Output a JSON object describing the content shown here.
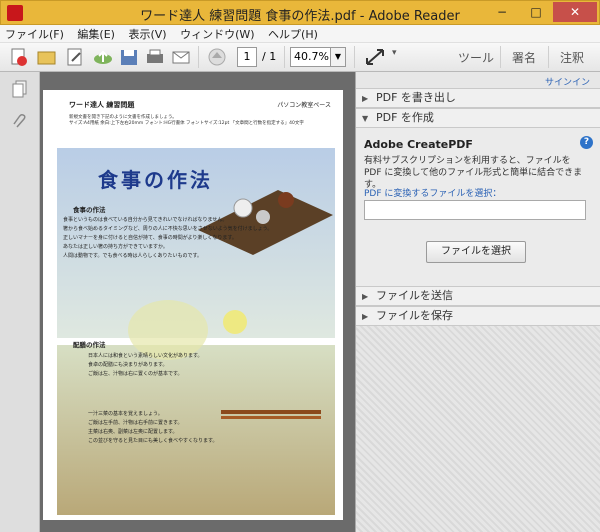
{
  "window": {
    "title": "ワード達人 練習問題 食事の作法.pdf - Adobe Reader"
  },
  "menu": [
    "ファイル(F)",
    "編集(E)",
    "表示(V)",
    "ウィンドウ(W)",
    "ヘルプ(H)"
  ],
  "toolbar": {
    "page_current": "1",
    "page_total": "/ 1",
    "zoom": "40.7%",
    "tools_label": "ツール",
    "sign_label": "署名",
    "comment_label": "注釈"
  },
  "panel": {
    "signin": "サインイン",
    "export_label": "PDF を書き出し",
    "create_label": "PDF を作成",
    "createpdf_title": "Adobe CreatePDF",
    "createpdf_desc": "有料サブスクリプションを利用すると、ファイルを PDF に変換して他のファイル形式と簡単に結合できます。",
    "select_label": "PDF に変換するファイルを選択：",
    "select_button": "ファイルを選択",
    "send_label": "ファイルを送信",
    "save_label": "ファイルを保存"
  },
  "doc": {
    "header_left": "ワード達人 練習問題",
    "header_right": "パソコン教室ペース",
    "instruction1": "新規文書を開き下記のように文書を作成しましょう。",
    "instruction2": "サイズ:A4用紙 余白:上下左右20mm フォント:HG行書体 フォントサイズ:12pt 「文章間と行数を指定する」40文字",
    "title": "食事の作法",
    "sec1": "食事の作法",
    "sec2": "配膳の作法",
    "para1": [
      "食事というものは食べている自分から見てきれいでなければなりません。",
      "箸から食べ始めるタイミングなど、周りの人に不快な思いをさせないよう気を付けましょう。",
      "正しいマナーを身に付けると自信が持て、食事の時間がより楽しくなります。",
      "あなたは正しい箸の持ち方ができていますか。",
      "人間は動物です。でも食べる時は人らしくありたいものです。"
    ],
    "para2": [
      "日本人には和食という素晴らしい文化があります。",
      "食卓の配膳にも決まりがあります。",
      "ご飯は左、汁物は右に置くのが基本です。"
    ],
    "para3": [
      "一汁三菜の基本を覚えましょう。",
      "ご飯は左手前、汁物は右手前に置きます。",
      "主菜は右奥、副菜は左奥に配置します。",
      "この並びを守ると見た目にも美しく食べやすくなります。"
    ]
  },
  "colors": {
    "titlebar": "#e9b73a",
    "close": "#c7504a",
    "link": "#2b62b5",
    "doc_title": "#1e3a8c"
  }
}
